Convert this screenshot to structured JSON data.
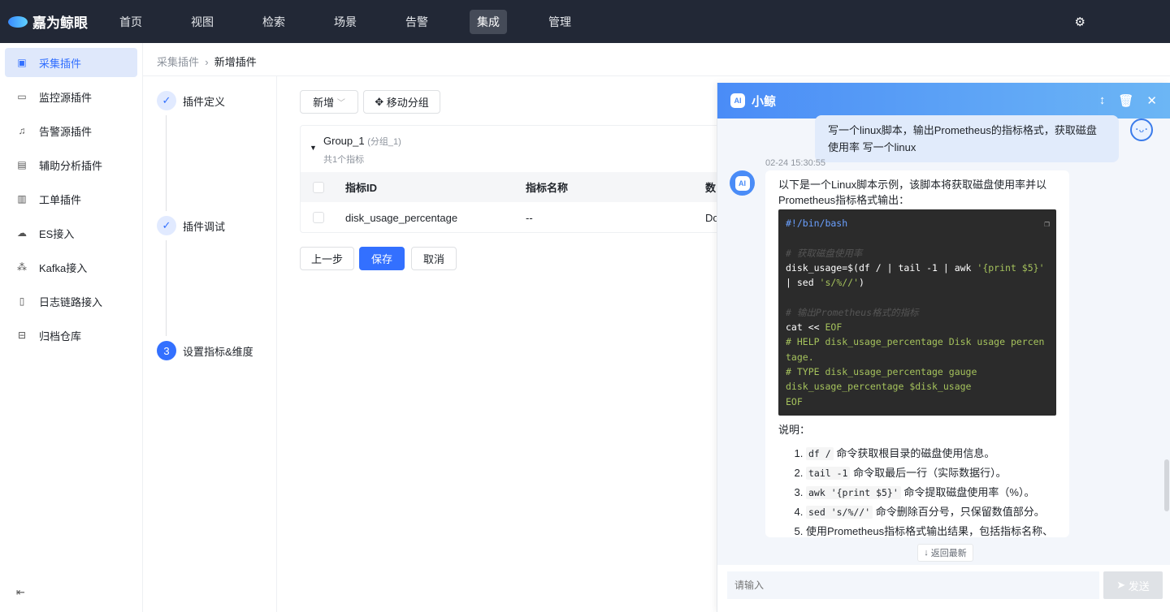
{
  "app": {
    "brand": "嘉为鲸眼",
    "nav": [
      "首页",
      "视图",
      "检索",
      "场景",
      "告警",
      "集成",
      "管理"
    ],
    "active_nav": 5
  },
  "sidebar": {
    "items": [
      {
        "label": "采集插件",
        "icon": "plugin-icon"
      },
      {
        "label": "监控源插件",
        "icon": "monitor-icon"
      },
      {
        "label": "告警源插件",
        "icon": "alarm-icon"
      },
      {
        "label": "辅助分析插件",
        "icon": "analysis-icon"
      },
      {
        "label": "工单插件",
        "icon": "ticket-icon"
      },
      {
        "label": "ES接入",
        "icon": "cloud-icon"
      },
      {
        "label": "Kafka接入",
        "icon": "kafka-icon"
      },
      {
        "label": "日志链路接入",
        "icon": "log-icon"
      },
      {
        "label": "归档仓库",
        "icon": "archive-icon"
      }
    ]
  },
  "breadcrumb": {
    "parent": "采集插件",
    "current": "新增插件"
  },
  "steps": [
    {
      "label": "插件定义",
      "state": "done"
    },
    {
      "label": "插件调试",
      "state": "done"
    },
    {
      "label": "设置指标&维度",
      "state": "current",
      "num": "3"
    }
  ],
  "toolbar": {
    "add": "新增",
    "move": "移动分组"
  },
  "group": {
    "name": "Group_1",
    "alias": "(分组_1)",
    "count": "共1个指标",
    "columns": [
      "指标ID",
      "指标名称",
      "数"
    ],
    "rows": [
      [
        "disk_usage_percentage",
        "--",
        "Do"
      ]
    ]
  },
  "actions": {
    "prev": "上一步",
    "save": "保存",
    "cancel": "取消"
  },
  "chat": {
    "title": "小鲸",
    "user_msg": "写一个linux脚本，输出Prometheus的指标格式，获取磁盘使用率 写一个linux",
    "timestamp": "02-24 15:30:55",
    "intro": "以下是一个Linux脚本示例，该脚本将获取磁盘使用率并以Prometheus指标格式输出：",
    "code": [
      [
        [
          "k",
          "#!/bin/bash"
        ]
      ],
      [],
      [
        [
          "c",
          "# 获取磁盘使用率"
        ]
      ],
      [
        [
          "",
          "disk_usage=$(df / | tail -1 | awk "
        ],
        [
          "s",
          "'{print $5}'"
        ],
        [
          "",
          " | sed "
        ],
        [
          "s",
          "'s/%//'"
        ],
        [
          "",
          ")"
        ]
      ],
      [],
      [
        [
          "c",
          "# 输出Prometheus格式的指标"
        ]
      ],
      [
        [
          "",
          "cat << "
        ],
        [
          "g",
          "EOF"
        ]
      ],
      [
        [
          "g",
          "# HELP disk_usage_percentage Disk usage percentage."
        ]
      ],
      [
        [
          "g",
          "# TYPE disk_usage_percentage gauge"
        ]
      ],
      [
        [
          "g",
          "disk_usage_percentage $disk_usage"
        ]
      ],
      [
        [
          "g",
          "EOF"
        ]
      ]
    ],
    "desc_title": "说明：",
    "list": [
      {
        "code": "df /",
        "text": "命令获取根目录的磁盘使用信息。"
      },
      {
        "code": "tail -1",
        "text": "命令取最后一行（实际数据行）。"
      },
      {
        "code": "awk '{print $5}'",
        "text": "命令提取磁盘使用率（%）。"
      },
      {
        "code": "sed 's/%//'",
        "text": "命令删除百分号，只保留数值部分。"
      },
      {
        "code": "",
        "text": "使用Prometheus指标格式输出结果，包括指标名称、"
      }
    ],
    "back_latest": "返回最新",
    "input_placeholder": "请输入",
    "send": "发送"
  }
}
